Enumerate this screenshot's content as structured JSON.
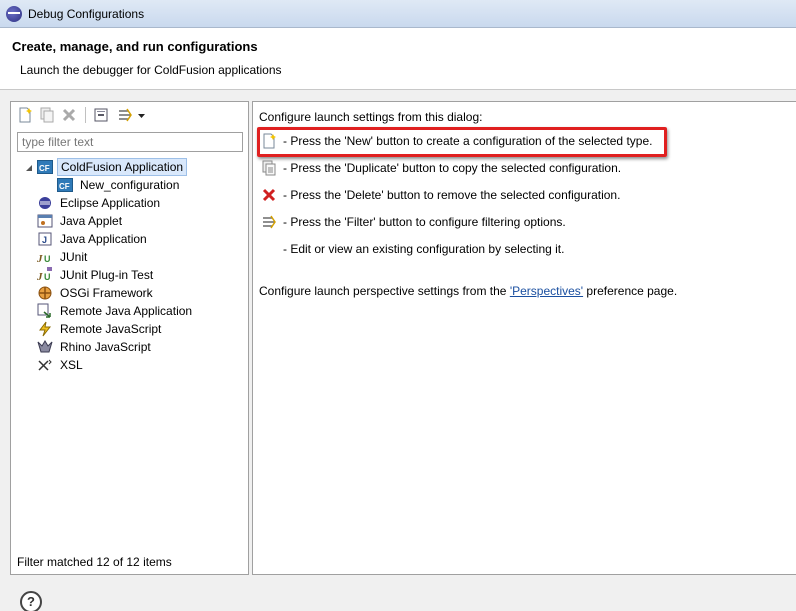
{
  "window": {
    "title": "Debug Configurations"
  },
  "header": {
    "title": "Create, manage, and run configurations",
    "subtitle": "Launch the debugger for ColdFusion applications"
  },
  "left": {
    "toolbar": [
      "new-config-icon",
      "duplicate-icon",
      "delete-icon",
      "collapse-all-icon",
      "filter-icon",
      "dropdown-arrow-icon"
    ],
    "filter_placeholder": "type filter text",
    "tree": [
      {
        "label": "ColdFusion Application",
        "icon": "coldfusion-icon",
        "selected": true,
        "expanded": true
      },
      {
        "label": "New_configuration",
        "icon": "coldfusion-icon",
        "child": true
      },
      {
        "label": "Eclipse Application",
        "icon": "eclipse-icon"
      },
      {
        "label": "Java Applet",
        "icon": "applet-icon"
      },
      {
        "label": "Java Application",
        "icon": "java-app-icon"
      },
      {
        "label": "JUnit",
        "icon": "junit-icon"
      },
      {
        "label": "JUnit Plug-in Test",
        "icon": "junit-plugin-icon"
      },
      {
        "label": "OSGi Framework",
        "icon": "osgi-icon"
      },
      {
        "label": "Remote Java Application",
        "icon": "remote-java-icon"
      },
      {
        "label": "Remote JavaScript",
        "icon": "remote-js-icon"
      },
      {
        "label": "Rhino JavaScript",
        "icon": "rhino-icon"
      },
      {
        "label": "XSL",
        "icon": "xsl-icon"
      }
    ],
    "status": "Filter matched 12 of 12 items"
  },
  "right": {
    "intro": "Configure launch settings from this dialog:",
    "lines": [
      {
        "icon": "new-config-icon",
        "text": "- Press the 'New' button to create a configuration of the selected type."
      },
      {
        "icon": "duplicate-icon",
        "text": "- Press the 'Duplicate' button to copy the selected configuration."
      },
      {
        "icon": "delete-icon",
        "text": "- Press the 'Delete' button to remove the selected configuration."
      },
      {
        "icon": "filter-icon",
        "text": "- Press the 'Filter' button to configure filtering options."
      },
      {
        "icon": "",
        "text": "- Edit or view an existing configuration by selecting it."
      }
    ],
    "perspective_prefix": "Configure launch perspective settings from the ",
    "perspective_link": "'Perspectives'",
    "perspective_suffix": " preference page."
  },
  "footer": {
    "help_label": "?"
  },
  "colors": {
    "highlight": "#e02020",
    "link": "#1a4fa0",
    "selection": "#d9e8fb"
  }
}
